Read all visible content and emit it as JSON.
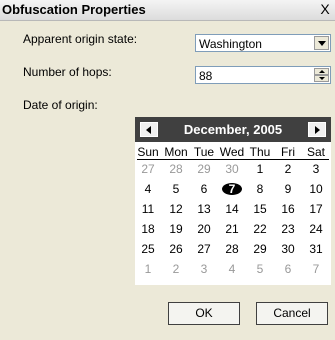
{
  "window": {
    "title": "Obfuscation Properties",
    "close_glyph": "X"
  },
  "fields": {
    "origin_state": {
      "label": "Apparent origin state:",
      "value": "Washington"
    },
    "hops": {
      "label": "Number of hops:",
      "value": "88"
    },
    "date": {
      "label": "Date of origin:"
    }
  },
  "calendar": {
    "month_label": "December, 2005",
    "weekdays": [
      "Sun",
      "Mon",
      "Tue",
      "Wed",
      "Thu",
      "Fri",
      "Sat"
    ],
    "selected_day": "7",
    "weeks": [
      [
        "27",
        "28",
        "29",
        "30",
        "1",
        "2",
        "3"
      ],
      [
        "4",
        "5",
        "6",
        "7",
        "8",
        "9",
        "10"
      ],
      [
        "11",
        "12",
        "13",
        "14",
        "15",
        "16",
        "17"
      ],
      [
        "18",
        "19",
        "20",
        "21",
        "22",
        "23",
        "24"
      ],
      [
        "25",
        "26",
        "27",
        "28",
        "29",
        "30",
        "31"
      ],
      [
        "1",
        "2",
        "3",
        "4",
        "5",
        "6",
        "7"
      ]
    ],
    "other_month_flags": [
      [
        true,
        true,
        true,
        true,
        false,
        false,
        false
      ],
      [
        false,
        false,
        false,
        false,
        false,
        false,
        false
      ],
      [
        false,
        false,
        false,
        false,
        false,
        false,
        false
      ],
      [
        false,
        false,
        false,
        false,
        false,
        false,
        false
      ],
      [
        false,
        false,
        false,
        false,
        false,
        false,
        false
      ],
      [
        true,
        true,
        true,
        true,
        true,
        true,
        true
      ]
    ]
  },
  "buttons": {
    "ok": "OK",
    "cancel": "Cancel"
  }
}
